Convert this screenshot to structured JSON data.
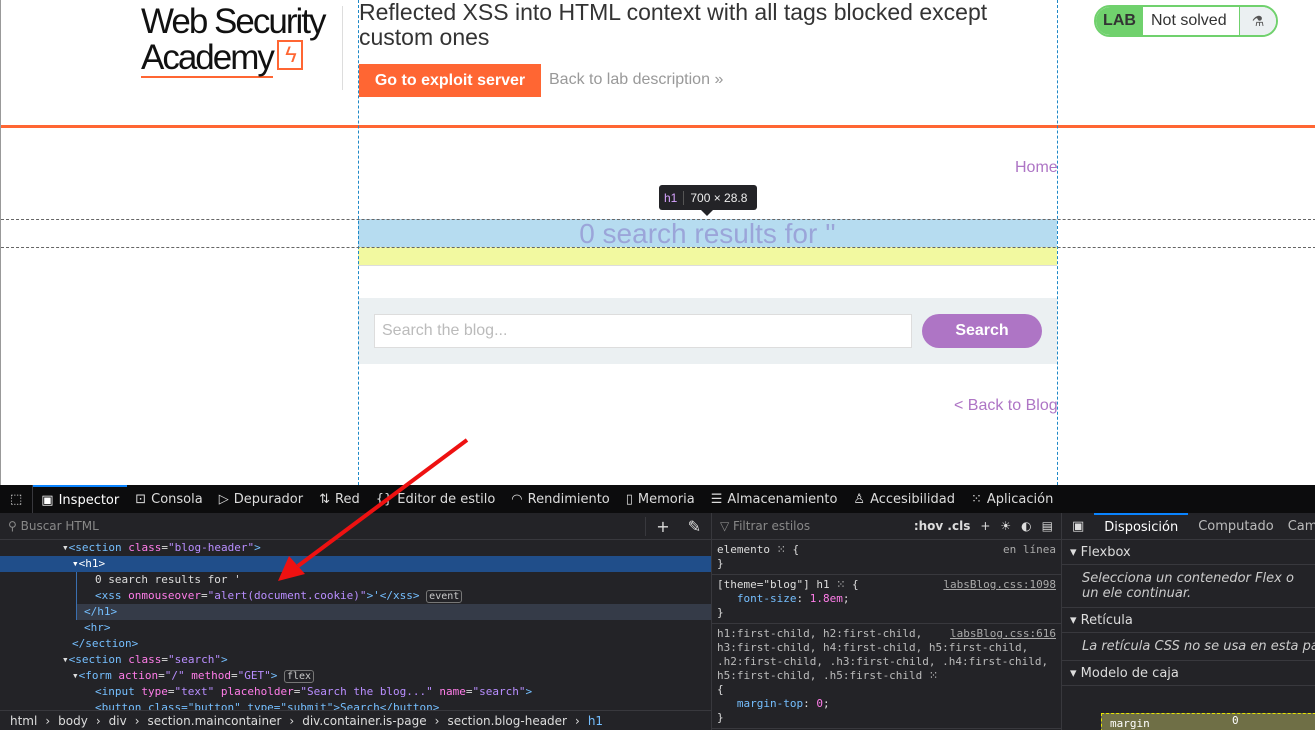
{
  "header": {
    "logo_line1": "Web Security",
    "logo_line2": "Academy",
    "lab_title": "Reflected XSS into HTML context with all tags blocked except custom ones",
    "exploit_button": "Go to exploit server",
    "back_to_lab": "Back to lab description",
    "lab_badge": "LAB",
    "lab_status": "Not solved"
  },
  "nav": {
    "home": "Home"
  },
  "blog": {
    "heading": "0 search results for ''",
    "search_placeholder": "Search the blog...",
    "search_button": "Search",
    "back_to_blog": "< Back to Blog"
  },
  "tooltip": {
    "tag": "h1",
    "size": "700 × 28.8"
  },
  "devtools": {
    "tabs": [
      "Inspector",
      "Consola",
      "Depurador",
      "Red",
      "Editor de estilo",
      "Rendimiento",
      "Memoria",
      "Almacenamiento",
      "Accesibilidad",
      "Aplicación"
    ],
    "search_html_placeholder": "Buscar HTML",
    "markup": {
      "l1a": "<section ",
      "l1b": "class",
      "l1c": "\"blog-header\"",
      "l1d": ">",
      "l2": "<h1>",
      "l3": "0 search results for '",
      "l4a": "<xss ",
      "l4b": "onmouseover",
      "l4c": "\"alert(document.cookie)\"",
      "l4d": ">'</xss>",
      "l4badge": "event",
      "l5": "</h1>",
      "l6": "<hr>",
      "l7": "</section>",
      "l8a": "<section ",
      "l8b": "class",
      "l8c": "\"search\"",
      "l8d": ">",
      "l9a": "<form ",
      "l9b": "action",
      "l9c": "\"/\"",
      "l9e": "method",
      "l9f": "\"GET\"",
      "l9d": ">",
      "l9badge": "flex",
      "l10a": "<input ",
      "l10b": "type",
      "l10c": "\"text\"",
      "l10e": "placeholder",
      "l10f": "\"Search the blog...\"",
      "l10g": "name",
      "l10h": "\"search\"",
      "l10d": ">",
      "l11": "<button class=\"button\" type=\"submit\">Search</button>"
    },
    "breadcrumbs": [
      "html",
      "body",
      "div",
      "section.maincontainer",
      "div.container.is-page",
      "section.blog-header",
      "h1"
    ],
    "styles": {
      "filter_placeholder": "Filtrar estilos",
      "hov": ":hov .cls",
      "r1_sel": "elemento",
      "r1_src": "en línea",
      "r2_sel": "[theme=\"blog\"] h1",
      "r2_src": "labsBlog.css:1098",
      "r2_prop": "font-size",
      "r2_val": "1.8em",
      "r3_sel": "h1:first-child, h2:first-child, h3:first-child, h4:first-child, h5:first-child, .h2:first-child, .h3:first-child, .h4:first-child, h5:first-child, .h5:first-child",
      "r3_src": "labsBlog.css:616",
      "r3_prop": "margin-top",
      "r3_val": "0"
    },
    "layout": {
      "tabs": [
        "Disposición",
        "Computado",
        "Camb"
      ],
      "flexbox": "Flexbox",
      "flex_msg": "Selecciona un contenedor Flex o un ele continuar.",
      "grid": "Retícula",
      "grid_msg": "La retícula CSS no se usa en esta págin",
      "box": "Modelo de caja",
      "margin": "margin",
      "margin_val": "0"
    }
  },
  "colors": {
    "accent_orange": "#ff6633",
    "lab_green": "#70d16d",
    "blog_purple": "#ae75c5",
    "highlight_blue": "#b6dcf0",
    "highlight_yellow": "#f2f9a0",
    "arrow": "#ee1111"
  }
}
